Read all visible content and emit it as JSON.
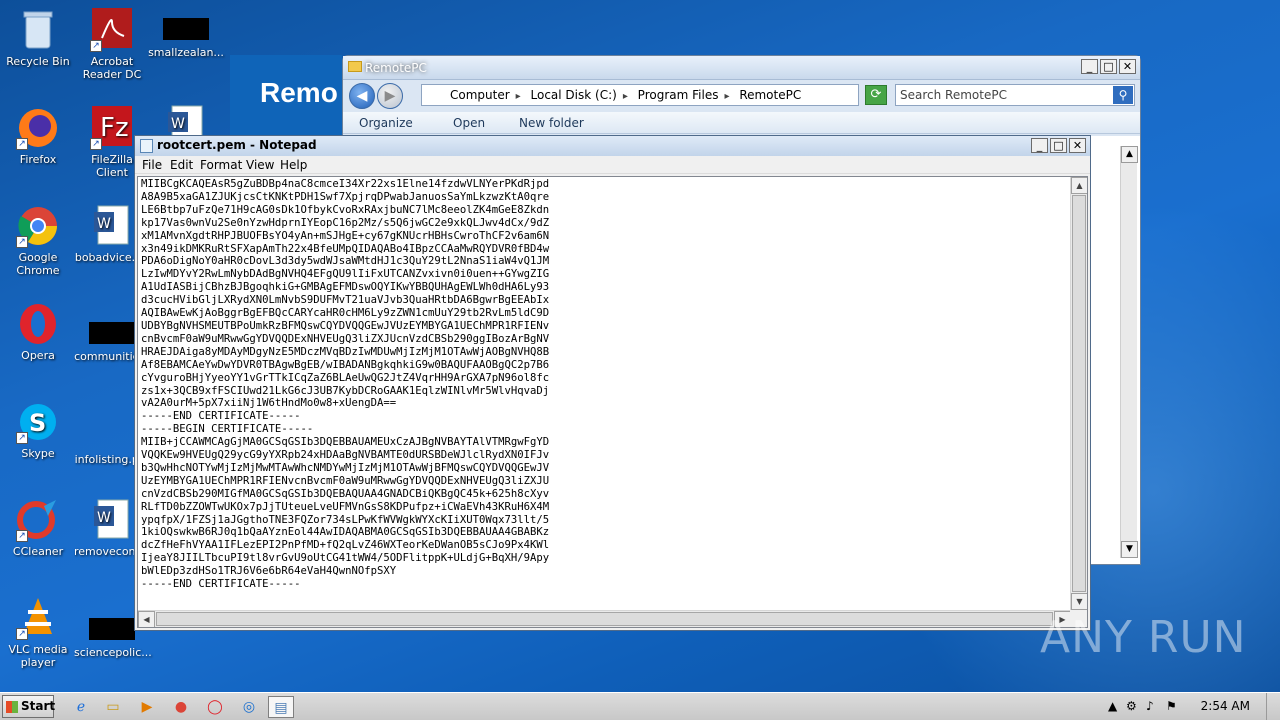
{
  "desktop": {
    "icons": [
      {
        "label": "Recycle Bin",
        "icon": "recycle-bin-icon"
      },
      {
        "label": "Acrobat Reader DC",
        "icon": "acrobat-icon"
      },
      {
        "label": "smallzealan...",
        "icon": "file-icon"
      },
      {
        "label": "Firefox",
        "icon": "firefox-icon"
      },
      {
        "label": "FileZilla Client",
        "icon": "filezilla-icon"
      },
      {
        "label": "Google Chrome",
        "icon": "chrome-icon"
      },
      {
        "label": "bobadvice.r...",
        "icon": "word-doc-icon"
      },
      {
        "label": "Opera",
        "icon": "opera-icon"
      },
      {
        "label": "communitie...",
        "icon": "file-icon"
      },
      {
        "label": "Skype",
        "icon": "skype-icon"
      },
      {
        "label": "infolisting.p...",
        "icon": "file-icon"
      },
      {
        "label": "CCleaner",
        "icon": "ccleaner-icon"
      },
      {
        "label": "removecont...",
        "icon": "word-doc-icon"
      },
      {
        "label": "VLC media player",
        "icon": "vlc-icon"
      },
      {
        "label": "sciencepolic...",
        "icon": "file-icon"
      }
    ]
  },
  "explorer": {
    "title": "RemotePC",
    "breadcrumb": [
      "Computer",
      "Local Disk (C:)",
      "Program Files",
      "RemotePC"
    ],
    "search_placeholder": "Search RemotePC",
    "toolbar": {
      "organize": "Organize",
      "open": "Open",
      "new_folder": "New folder"
    },
    "banner_text": "Remo"
  },
  "notepad": {
    "title": "rootcert.pem - Notepad",
    "menu": [
      "File",
      "Edit",
      "Format",
      "View",
      "Help"
    ],
    "content": "MIIBCgKCAQEAsR5gZuBDBp4naC8cmceI34Xr22xs1Elne14fzdwVLNYerPKdRjpd\nA8A9B5xaGA1ZJUKjcsCtKNKtPDH1Swf7XpjrqDPwabJanuosSaYmLkzwzKtA0qre\nLE6Btbp7uFzQe71H9cAG0sDk1OfbykCvoRxRAxjbuNC7lMc8eeolZK4mGeE8Zkdn\nkp17Vas0wnVu2Se0nYzwHdprnIYEopC16p2Mz/s5Q6jwGC2e9xkQLJwv4dCx/9dZ\nxM1AMvnXgdtRHPJBUOFBsYO4yAn+mSJHgE+cy67gKNUcrHBHsCwroThCF2v6am6N\nx3n49ikDMKRuRtSFXapAmTh22x4BfeUMpQIDAQABo4IBpzCCAaMwRQYDVR0fBD4w\nPDA6oDigNoY0aHR0cDovL3d3dy5wdWJsaWMtdHJ1c3QuY29tL2NnaS1iaW4vQ1JM\nLzIwMDYvY2RwLmNybDAdBgNVHQ4EFgQU9lIiFxUTCANZvxivn0i0uen++GYwgZIG\nA1UdIASBijCBhzBJBgoqhkiG+GMBAgEFMDswOQYIKwYBBQUHAgEWLWh0dHA6Ly93\nd3cucHVibGljLXRydXN0LmNvbS9DUFMvT21uaVJvb3QuaHRtbDA6BgwrBgEEAbIx\nAQIBAwEwKjAoBggrBgEFBQcCARYcaHR0cHM6Ly9zZWN1cmUuY29tb2RvLm5ldC9D\nUDBYBgNVHSMEUTBPoUmkRzBFMQswCQYDVQQGEwJVUzEYMBYGA1UEChMPR1RFIENv\ncnBvcmF0aW9uMRwwGgYDVQQDExNHVEUgQ3liZXJUcnVzdCBSb290ggIBozArBgNV\nHRAEJDAiga8yMDAyMDgyNzE5MDczMVqBDzIwMDUwMjIzMjM1OTAwWjAOBgNVHQ8B\nAf8EBAMCAeYwDwYDVR0TBAgwBgEB/wIBADANBgkqhkiG9w0BAQUFAAOBgQC2p7B6\ncYvguroBHjYyeoYY1vGrTTkICqZaZ6BLAeUwQG2JtZ4VqrHH9ArGXA7pN96ol8fc\nzs1x+3QCB9xfFSCIUwd21LkG6cJ3UB7KybDCRoGAAK1EqlzWINlvMr5WlvHqvaDj\nvA2A0urM+5pX7xiiNj1W6tHndMo0w8+xUengDA==\n-----END CERTIFICATE-----\n-----BEGIN CERTIFICATE-----\nMIIB+jCCAWMCAgGjMA0GCSqGSIb3DQEBBAUAMEUxCzAJBgNVBAYTAlVTMRgwFgYD\nVQQKEw9HVEUgQ29ycG9yYXRpb24xHDAaBgNVBAMTE0dURSBDeWJlclRydXN0IFJv\nb3QwHhcNOTYwMjIzMjMwMTAwWhcNMDYwMjIzMjM1OTAwWjBFMQswCQYDVQQGEwJV\nUzEYMBYGA1UEChMPR1RFIENvcnBvcmF0aW9uMRwwGgYDVQQDExNHVEUgQ3liZXJU\ncnVzdCBSb290MIGfMA0GCSqGSIb3DQEBAQUAA4GNADCBiQKBgQC45k+625h8cXyv\nRLfTD0bZZOWTwUKOx7pJjTUteueLveUFMVnGsS8KDPufpz+iCWaEVh43KRuH6X4M\nypqfpX/1FZSj1aJGgthoTNE3FQZor734sLPwKfWVWgkWYXcKIiXUT0Wqx73llt/5\n1kiOQswkwB6RJ0q1bQaAYznEol44AwIDAQABMA0GCSqGSIb3DQEBBAUAA4GBABKz\ndcZfHeFhVYAA1IFLezEPI2PnPfMD+fQ2qLvZ46WXTeorKeDWanOB5sCJo9Px4KWl\nIjeaY8JIILTbcuPI9tl8vrGvU9oUtCG41tWW4/5ODFlitppK+ULdjG+BqXH/9Apy\nbWlEDp3zdHSo1TRJ6V6e6bR64eVaH4QwnNOfpSXY\n-----END CERTIFICATE-----"
  },
  "watermark": "ANY RUN",
  "taskbar": {
    "start_label": "Start",
    "clock": "2:54 AM"
  }
}
